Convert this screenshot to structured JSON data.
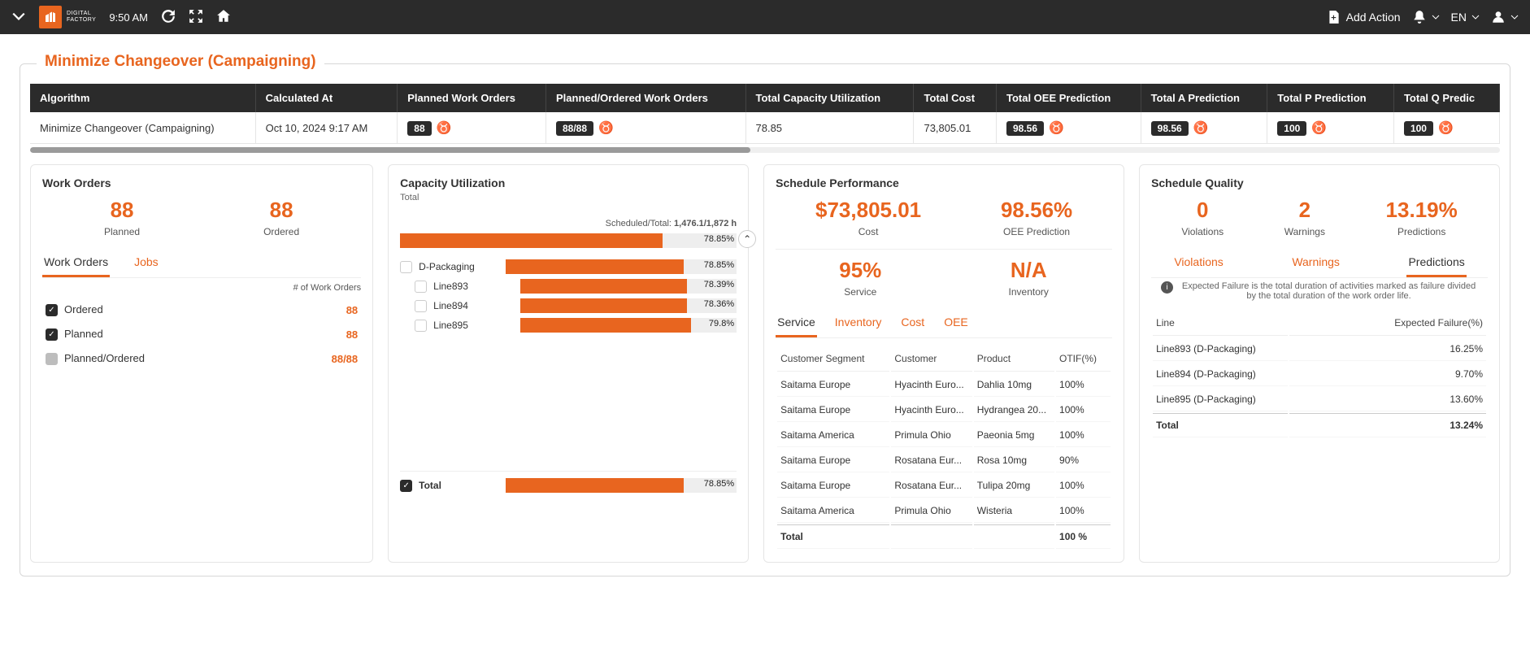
{
  "topbar": {
    "time": "9:50 AM",
    "brand1": "DIGITAL",
    "brand2": "FACTORY",
    "add_action": "Add Action",
    "lang": "EN"
  },
  "section": {
    "title": "Minimize Changeover (Campaigning)"
  },
  "table": {
    "headers": [
      "Algorithm",
      "Calculated At",
      "Planned Work Orders",
      "Planned/Ordered Work Orders",
      "Total Capacity Utilization",
      "Total Cost",
      "Total OEE Prediction",
      "Total A Prediction",
      "Total P Prediction",
      "Total Q Predic"
    ],
    "row": {
      "algo": "Minimize Changeover (Campaigning)",
      "calc": "Oct 10, 2024 9:17 AM",
      "planned": "88",
      "po": "88/88",
      "cap": "78.85",
      "cost": "73,805.01",
      "oee": "98.56",
      "a": "98.56",
      "p": "100",
      "q": "100"
    }
  },
  "work_orders": {
    "title": "Work Orders",
    "planned_v": "88",
    "planned_l": "Planned",
    "ordered_v": "88",
    "ordered_l": "Ordered",
    "tabs": {
      "wo": "Work Orders",
      "jobs": "Jobs"
    },
    "count_hdr": "# of Work Orders",
    "rows": [
      {
        "label": "Ordered",
        "val": "88",
        "chk": true
      },
      {
        "label": "Planned",
        "val": "88",
        "chk": true
      },
      {
        "label": "Planned/Ordered",
        "val": "88/88",
        "chk": false
      }
    ]
  },
  "capacity": {
    "title": "Capacity Utilization",
    "sub": "Total",
    "sched": "Scheduled/Total: ",
    "sched_v": "1,476.1/1,872 h",
    "total_pct": "78.85%",
    "groups": [
      {
        "label": "D-Packaging",
        "pct": "78.85%",
        "fill": 77,
        "indent": 0
      },
      {
        "label": "Line893",
        "pct": "78.39%",
        "fill": 77,
        "indent": 1
      },
      {
        "label": "Line894",
        "pct": "78.36%",
        "fill": 77,
        "indent": 1
      },
      {
        "label": "Line895",
        "pct": "79.8%",
        "fill": 79,
        "indent": 1
      }
    ],
    "footer": {
      "label": "Total",
      "pct": "78.85%",
      "fill": 77
    }
  },
  "performance": {
    "title": "Schedule Performance",
    "cost": "$73,805.01",
    "cost_l": "Cost",
    "oee": "98.56%",
    "oee_l": "OEE Prediction",
    "service": "95%",
    "service_l": "Service",
    "inv": "N/A",
    "inv_l": "Inventory",
    "tabs": [
      "Service",
      "Inventory",
      "Cost",
      "OEE"
    ],
    "columns": [
      "Customer Segment",
      "Customer",
      "Product",
      "OTIF(%)"
    ],
    "rows": [
      [
        "Saitama Europe",
        "Hyacinth Euro...",
        "Dahlia 10mg",
        "100%"
      ],
      [
        "Saitama Europe",
        "Hyacinth Euro...",
        "Hydrangea 20...",
        "100%"
      ],
      [
        "Saitama America",
        "Primula Ohio",
        "Paeonia 5mg",
        "100%"
      ],
      [
        "Saitama Europe",
        "Rosatana Eur...",
        "Rosa 10mg",
        "90%"
      ],
      [
        "Saitama Europe",
        "Rosatana Eur...",
        "Tulipa 20mg",
        "100%"
      ],
      [
        "Saitama America",
        "Primula Ohio",
        "Wisteria",
        "100%"
      ]
    ],
    "total": "Total",
    "total_v": "100 %"
  },
  "quality": {
    "title": "Schedule Quality",
    "v": "0",
    "v_l": "Violations",
    "w": "2",
    "w_l": "Warnings",
    "p": "13.19%",
    "p_l": "Predictions",
    "tabs": [
      "Violations",
      "Warnings",
      "Predictions"
    ],
    "help": "Expected Failure is the total duration of activities marked as failure divided by the total duration of the work order life.",
    "columns": [
      "Line",
      "Expected Failure(%)"
    ],
    "rows": [
      [
        "Line893 (D-Packaging)",
        "16.25%"
      ],
      [
        "Line894 (D-Packaging)",
        "9.70%"
      ],
      [
        "Line895 (D-Packaging)",
        "13.60%"
      ]
    ],
    "total": "Total",
    "total_v": "13.24%"
  }
}
